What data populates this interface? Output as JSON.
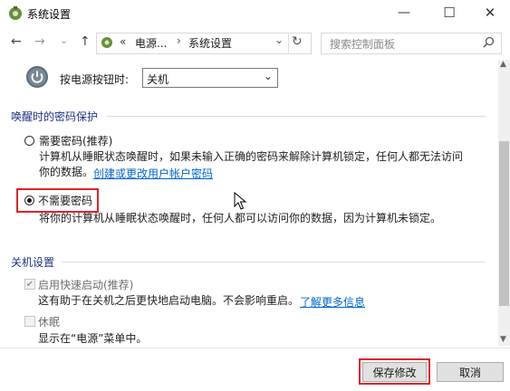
{
  "window": {
    "title": "系统设置",
    "minimize_glyph": "—",
    "maximize_glyph": "☐",
    "close_glyph": "✕"
  },
  "nav": {
    "back_glyph": "←",
    "forward_glyph": "→",
    "dropdown_glyph": "⌄",
    "up_glyph": "↑",
    "breadcrumb": {
      "prefix": "«",
      "item1": "电源...",
      "sep": "›",
      "item2": "系统设置"
    },
    "address_dropdown_glyph": "⌄",
    "refresh_glyph": "↻",
    "search_placeholder": "搜索控制面板",
    "search_icon": "search-icon"
  },
  "power_button": {
    "label": "按电源按钮时:",
    "selected": "关机"
  },
  "wake_password": {
    "title": "唤醒时的密码保护",
    "options": [
      {
        "label": "需要密码(推荐)",
        "checked": false,
        "desc_line1": "计算机从睡眠状态唤醒时，如果未输入正确的密码来解除计算机锁定，任何人都无法访问",
        "desc_line2": "你的数据。",
        "link": "创建或更改用户帐户密码"
      },
      {
        "label": "不需要密码",
        "checked": true,
        "desc_line1": "将你的计算机从睡眠状态唤醒时，任何人都可以访问你的数据，因为计算机未锁定。"
      }
    ]
  },
  "shutdown_settings": {
    "title": "关机设置",
    "items": [
      {
        "label": "启用快速启动(推荐)",
        "checked": true,
        "desc": "这有助于在关机之后更快地启动电脑。不会影响重启。",
        "link": "了解更多信息"
      },
      {
        "label": "休眠",
        "checked": false,
        "desc": "显示在“电源”菜单中。"
      }
    ]
  },
  "footer": {
    "save_label": "保存修改",
    "cancel_label": "取消"
  },
  "colors": {
    "highlight": "#e0242a",
    "section_title": "#1e3287",
    "link": "#0066cc"
  }
}
